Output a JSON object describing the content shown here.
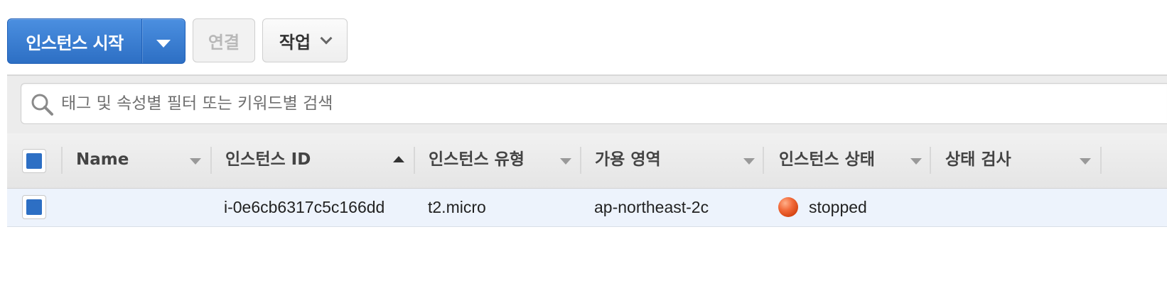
{
  "toolbar": {
    "launch_label": "인스턴스 시작",
    "connect_label": "연결",
    "actions_label": "작업"
  },
  "search": {
    "placeholder": "태그 및 속성별 필터 또는 키워드별 검색"
  },
  "table": {
    "columns": [
      {
        "label": "Name"
      },
      {
        "label": "인스턴스 ID"
      },
      {
        "label": "인스턴스 유형"
      },
      {
        "label": "가용 영역"
      },
      {
        "label": "인스턴스 상태"
      },
      {
        "label": "상태 검사"
      }
    ],
    "sorted_column": "인스턴스 ID",
    "sort_direction": "ascending",
    "rows": [
      {
        "name": "",
        "instance_id": "i-0e6cb6317c5c166dd",
        "instance_type": "t2.micro",
        "availability_zone": "ap-northeast-2c",
        "state": "stopped",
        "status_check": ""
      }
    ]
  },
  "colors": {
    "primary": "#2d6fc4",
    "row_selected_bg": "#edf3fc",
    "stopped": "#e8582a"
  },
  "icons": {
    "search": "search-icon",
    "dropdown": "caret-down-icon",
    "actions": "chevron-down-icon",
    "sort": "sort-icon",
    "status": "stopped-status-icon"
  }
}
